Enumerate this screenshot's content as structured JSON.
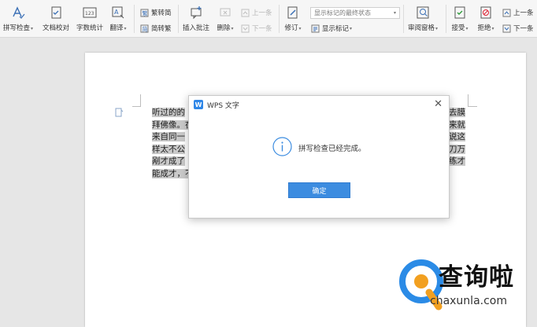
{
  "ribbon": {
    "spellcheck": "拼写检查",
    "doc_proof": "文档校对",
    "word_count": "字数统计",
    "translate": "翻译",
    "trad_to_simp": "繁转简",
    "simp_to_trad": "简转繁",
    "insert_comment": "插入批注",
    "delete": "删除",
    "prev_comment": "上一条",
    "next_comment": "下一条",
    "revise": "修订",
    "display_select": "显示标记的最终状态",
    "show_markup": "显示标记",
    "review_pane": "审阅窗格",
    "accept": "接受",
    "reject": "拒绝",
    "prev_change": "上一条",
    "next_change": "下一条"
  },
  "document": {
    "left_lines": [
      "听过的的",
      "拜佛像。在",
      "来自同一",
      "样太不公",
      "剐才成了",
      "能成才，不"
    ],
    "right_lines": [
      "去膜",
      "来就",
      "说这",
      "刀万",
      "练才",
      ""
    ]
  },
  "dialog": {
    "title": "WPS 文字",
    "logo_letter": "W",
    "close": "✕",
    "message": "拼写检查已经完成。",
    "ok": "确定"
  },
  "watermark": {
    "brand": "查询啦",
    "url": "chaxunla.com"
  },
  "colors": {
    "accent": "#3c8ce0",
    "selection": "#c9c9c9"
  }
}
